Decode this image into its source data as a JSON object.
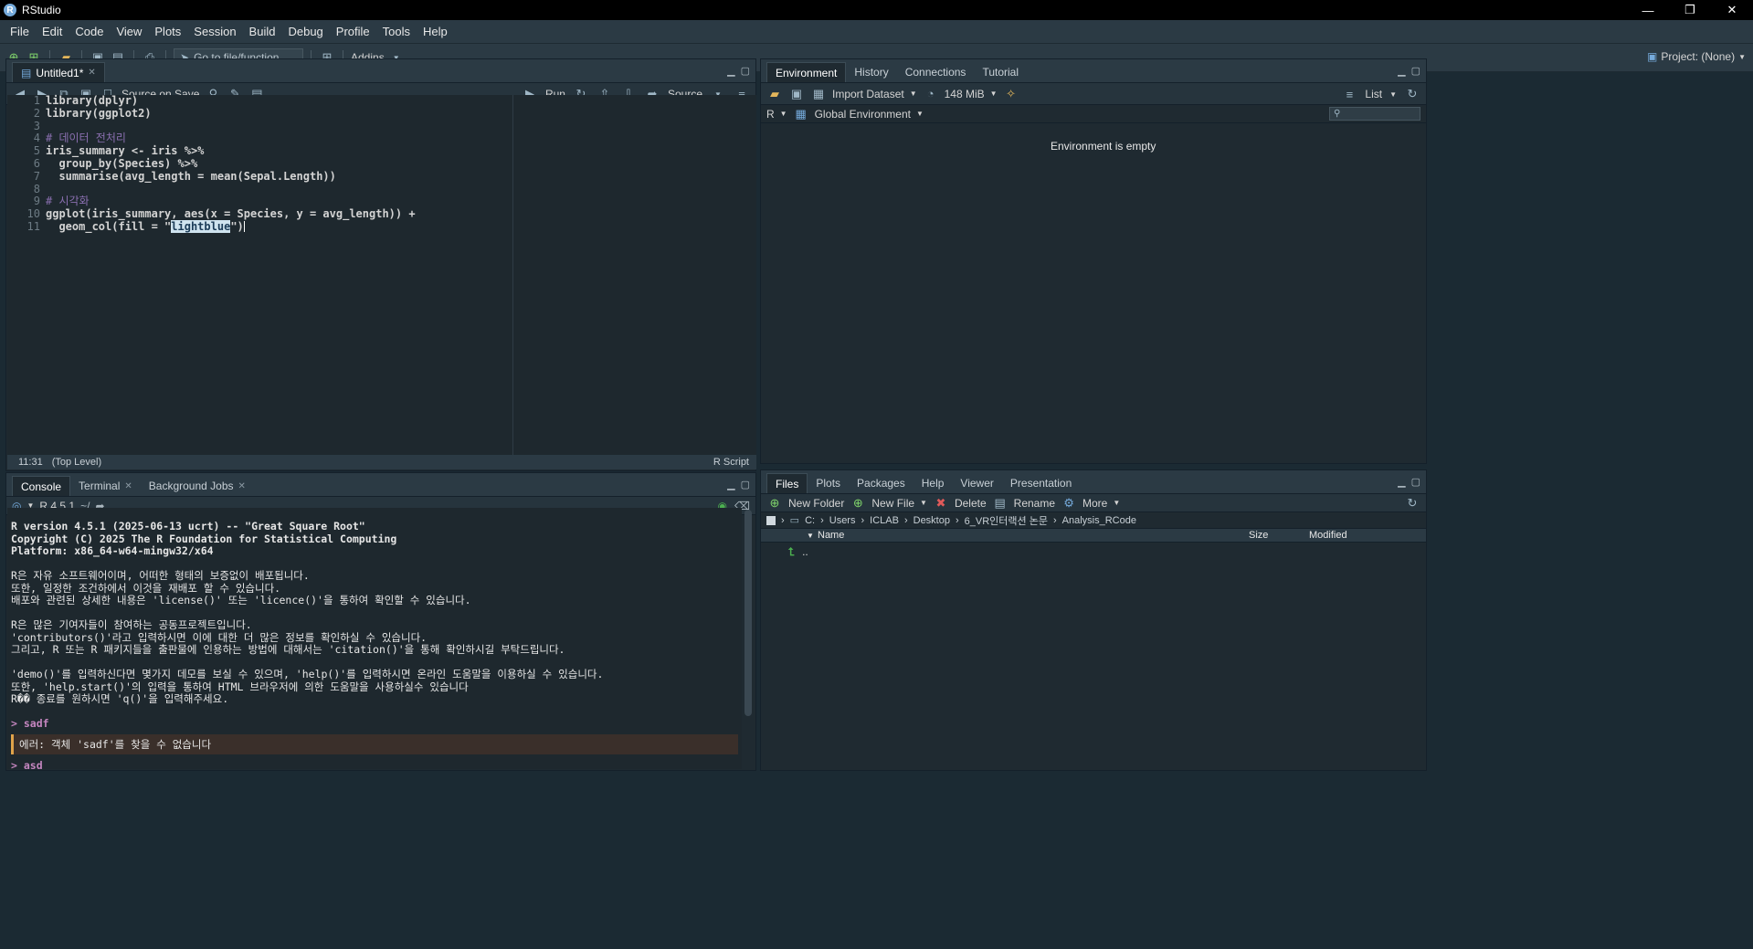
{
  "window": {
    "title": "RStudio",
    "logo_letter": "R",
    "min": "—",
    "restore": "❐",
    "close": "✕"
  },
  "menu": [
    "File",
    "Edit",
    "Code",
    "View",
    "Plots",
    "Session",
    "Build",
    "Debug",
    "Profile",
    "Tools",
    "Help"
  ],
  "toolbar": {
    "goto_placeholder": "Go to file/function",
    "addins": "Addins",
    "project": "Project: (None)"
  },
  "editor": {
    "tab": "Untitled1*",
    "source_on_save": "Source on Save",
    "run": "Run",
    "source": "Source",
    "lines": [
      "library(dplyr)",
      "library(ggplot2)",
      "",
      "# 데이터 전처리",
      "iris_summary <- iris %>%",
      "  group_by(Species) %>%",
      "  summarise(avg_length = mean(Sepal.Length))",
      "",
      "# 시각화",
      "ggplot(iris_summary, aes(x = Species, y = avg_length)) +",
      "  geom_col(fill = \"lightblue\")"
    ],
    "line_numbers": [
      "1",
      "2",
      "3",
      "4",
      "5",
      "6",
      "7",
      "8",
      "9",
      "10",
      "11"
    ],
    "status_pos": "11:31",
    "status_scope": "(Top Level)",
    "status_type": "R Script"
  },
  "console": {
    "tabs": [
      "Console",
      "Terminal",
      "Background Jobs"
    ],
    "r_version": "R 4.5.1",
    "path": "~/",
    "lines": [
      "R version 4.5.1 (2025-06-13 ucrt) -- \"Great Square Root\"",
      "Copyright (C) 2025 The R Foundation for Statistical Computing",
      "Platform: x86_64-w64-mingw32/x64",
      "",
      "R은 자유 소프트웨어이며, 어떠한 형태의 보증없이 배포됩니다.",
      "또한, 일정한 조건하에서 이것을 재배포 할 수 있습니다.",
      "배포와 관련된 상세한 내용은 'license()' 또는 'licence()'을 통하여 확인할 수 있습니다.",
      "",
      "R은 많은 기여자들이 참여하는 공동프로젝트입니다.",
      "'contributors()'라고 입력하시면 이에 대한 더 많은 정보를 확인하실 수 있습니다.",
      "그리고, R 또는 R 패키지들을 출판물에 인용하는 방법에 대해서는 'citation()'을 통해 확인하시길 부탁드립니다.",
      "",
      "'demo()'를 입력하신다면 몇가지 데모를 보실 수 있으며, 'help()'를 입력하시면 온라인 도움말을 이용하실 수 있습니다.",
      "또한, 'help.start()'의 입력을 통하여 HTML 브라우저에 의한 도움말을 사용하실수 있습니다",
      "R�� 종료를 원하시면 'q()'을 입력해주세요."
    ],
    "cmd1": "> sadf",
    "error": "에러: 객체 'sadf'를 찾을 수 없습니다",
    "cmd2": "> asd"
  },
  "environment": {
    "tabs": [
      "Environment",
      "History",
      "Connections",
      "Tutorial"
    ],
    "import_dataset": "Import Dataset",
    "memory": "148 MiB",
    "list": "List",
    "lang": "R",
    "scope": "Global Environment",
    "empty_msg": "Environment is empty"
  },
  "files": {
    "tabs": [
      "Files",
      "Plots",
      "Packages",
      "Help",
      "Viewer",
      "Presentation"
    ],
    "new_folder": "New Folder",
    "new_file": "New File",
    "delete": "Delete",
    "rename": "Rename",
    "more": "More",
    "breadcrumb": [
      "C:",
      "Users",
      "ICLAB",
      "Desktop",
      "6_VR인터랙션 논문",
      "Analysis_RCode"
    ],
    "col_name": "Name",
    "col_size": "Size",
    "col_modified": "Modified",
    "up_label": ".."
  }
}
